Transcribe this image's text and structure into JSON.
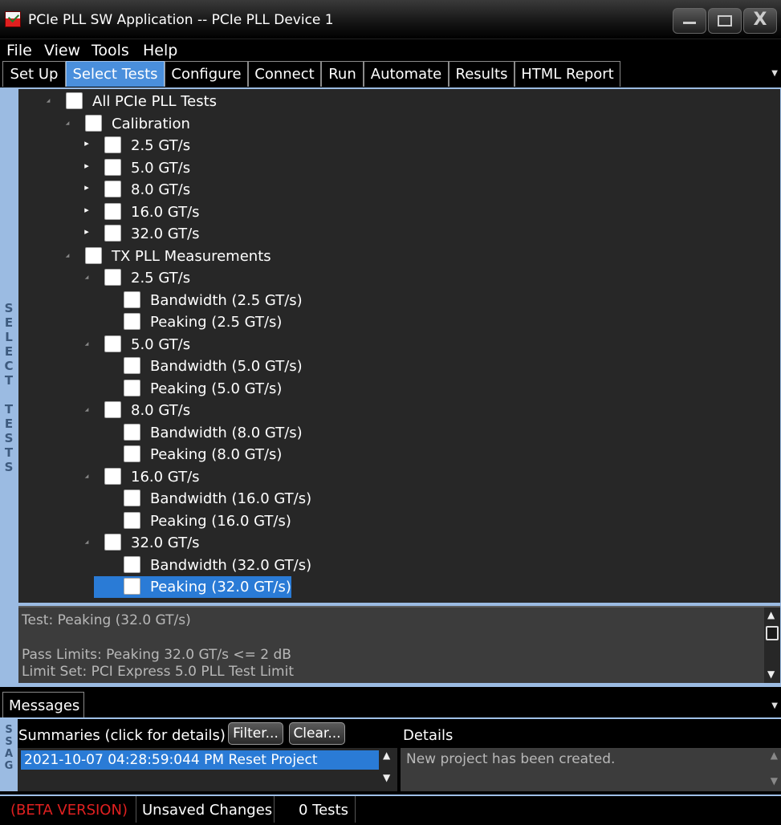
{
  "window": {
    "title": "PCIe PLL SW Application -- PCIe PLL Device 1",
    "min_icon": "minimize-icon",
    "max_icon": "maximize-icon",
    "close_icon": "close-icon",
    "close_glyph": "X"
  },
  "menu": [
    "File",
    "View",
    "Tools",
    "Help"
  ],
  "tabs": [
    "Set Up",
    "Select Tests",
    "Configure",
    "Connect",
    "Run",
    "Automate",
    "Results",
    "HTML Report"
  ],
  "active_tab": "Select Tests",
  "side_label": "SELECT TESTS",
  "tree": [
    {
      "label": "All PCIe PLL Tests",
      "level": 0,
      "expander": "expanded",
      "checked": false
    },
    {
      "label": "Calibration",
      "level": 1,
      "expander": "expanded",
      "checked": false
    },
    {
      "label": "2.5 GT/s",
      "level": 2,
      "expander": "collapsed",
      "checked": false
    },
    {
      "label": "5.0 GT/s",
      "level": 2,
      "expander": "collapsed",
      "checked": false
    },
    {
      "label": "8.0 GT/s",
      "level": 2,
      "expander": "collapsed",
      "checked": false
    },
    {
      "label": "16.0 GT/s",
      "level": 2,
      "expander": "collapsed",
      "checked": false
    },
    {
      "label": "32.0 GT/s",
      "level": 2,
      "expander": "collapsed",
      "checked": false
    },
    {
      "label": "TX PLL Measurements",
      "level": 1,
      "expander": "expanded",
      "checked": false
    },
    {
      "label": "2.5 GT/s",
      "level": 2,
      "expander": "expanded",
      "checked": false
    },
    {
      "label": "Bandwidth (2.5 GT/s)",
      "level": 3,
      "expander": "none",
      "checked": false
    },
    {
      "label": "Peaking (2.5 GT/s)",
      "level": 3,
      "expander": "none",
      "checked": false
    },
    {
      "label": "5.0 GT/s",
      "level": 2,
      "expander": "expanded",
      "checked": false
    },
    {
      "label": "Bandwidth (5.0 GT/s)",
      "level": 3,
      "expander": "none",
      "checked": false
    },
    {
      "label": "Peaking (5.0 GT/s)",
      "level": 3,
      "expander": "none",
      "checked": false
    },
    {
      "label": "8.0 GT/s",
      "level": 2,
      "expander": "expanded",
      "checked": false
    },
    {
      "label": "Bandwidth (8.0 GT/s)",
      "level": 3,
      "expander": "none",
      "checked": false
    },
    {
      "label": "Peaking (8.0 GT/s)",
      "level": 3,
      "expander": "none",
      "checked": false
    },
    {
      "label": "16.0 GT/s",
      "level": 2,
      "expander": "expanded",
      "checked": false
    },
    {
      "label": "Bandwidth (16.0 GT/s)",
      "level": 3,
      "expander": "none",
      "checked": false
    },
    {
      "label": "Peaking (16.0 GT/s)",
      "level": 3,
      "expander": "none",
      "checked": false
    },
    {
      "label": "32.0 GT/s",
      "level": 2,
      "expander": "expanded",
      "checked": false
    },
    {
      "label": "Bandwidth (32.0 GT/s)",
      "level": 3,
      "expander": "none",
      "checked": false
    },
    {
      "label": "Peaking (32.0 GT/s)",
      "level": 3,
      "expander": "none",
      "checked": false,
      "selected": true
    }
  ],
  "details": {
    "test": "Test: Peaking (32.0 GT/s)",
    "pass_limits": "Pass Limits: Peaking 32.0 GT/s <= 2 dB",
    "limit_set": "Limit Set: PCI Express 5.0 PLL Test Limit"
  },
  "messages": {
    "tab": "Messages",
    "side_label": "SSAG",
    "summaries_label": "Summaries (click for details)",
    "filter_button": "Filter...",
    "clear_button": "Clear...",
    "details_label": "Details",
    "summary_items": [
      "2021-10-07 04:28:59:044 PM Reset Project"
    ],
    "detail_text": "New project has been created."
  },
  "status": {
    "beta": "(BETA VERSION)",
    "beta_color": "#e02020",
    "unsaved": "Unsaved Changes",
    "tests": "0 Tests"
  }
}
